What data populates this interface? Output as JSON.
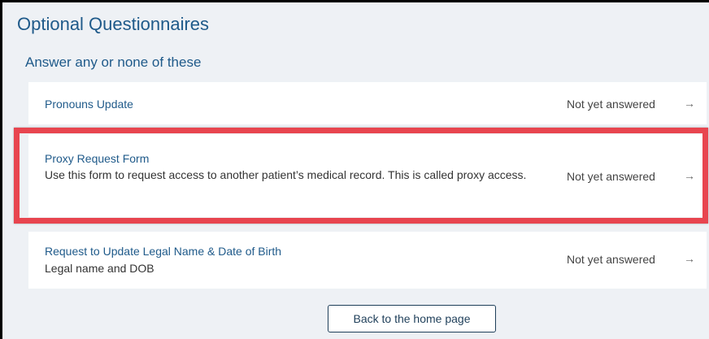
{
  "page": {
    "title": "Optional Questionnaires",
    "subtitle": "Answer any or none of these"
  },
  "questionnaires": [
    {
      "title": "Pronouns Update",
      "description": "",
      "status": "Not yet answered",
      "arrow_icon": "arrow-right-icon"
    },
    {
      "title": "Proxy Request Form",
      "description": "Use this form to request access to another patient’s medical record. This is called proxy access.",
      "status": "Not yet answered",
      "arrow_icon": "arrow-right-icon",
      "highlighted": true
    },
    {
      "title": "Request to Update Legal Name & Date of Birth",
      "description": "Legal name and DOB",
      "status": "Not yet answered",
      "arrow_icon": "arrow-right-icon"
    }
  ],
  "footer": {
    "back_button_label": "Back to the home page"
  },
  "colors": {
    "accent": "#1f5a8a",
    "highlight": "#e8454f",
    "background": "#eef1f5"
  }
}
